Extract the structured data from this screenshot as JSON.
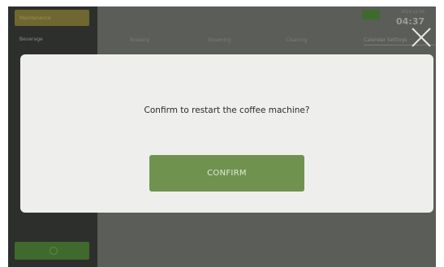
{
  "sidebar": {
    "top_button": "Maintenance",
    "item": "Beverage"
  },
  "tabs": [
    "Brewing",
    "Steaming",
    "Cleaning",
    "Calendar Settings"
  ],
  "header": {
    "date": "2019-12-06",
    "time": "04:37"
  },
  "dialog": {
    "message": "Confirm to restart the coffee machine?",
    "confirm_label": "CONFIRM"
  },
  "colors": {
    "confirm_button": "#6f934f",
    "dialog_background": "#eeefed",
    "overlay": "#5a5d58"
  },
  "icons": {
    "close": "close-icon",
    "power": "power-icon"
  }
}
